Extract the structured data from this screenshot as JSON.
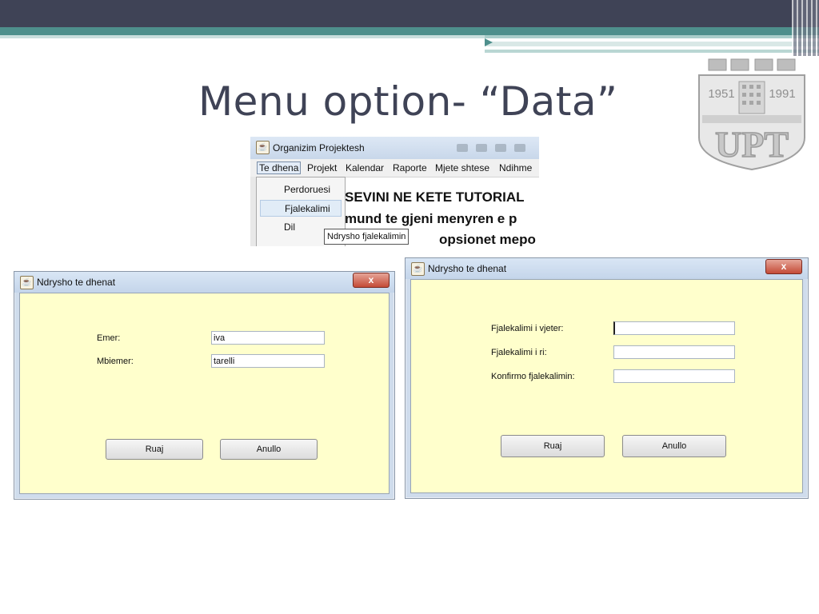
{
  "slide": {
    "title": "Menu option- “Data”"
  },
  "logo": {
    "year_left": "1951",
    "year_right": "1991",
    "text": "UPT"
  },
  "menu_window": {
    "title": "Organizim Projektesh",
    "menu": [
      "Te dhena",
      "Projekt",
      "Kalendar",
      "Raporte",
      "Mjete shtese",
      "Ndihme"
    ],
    "dropdown": [
      "Perdoruesi",
      "Fjalekalimi",
      "Dil"
    ],
    "tooltip": "Ndrysho fjalekalimin",
    "doc_lines": [
      "SEVINI NE KETE TUTORIAL",
      "mund te gjeni menyren e p",
      "opsionet mepo"
    ]
  },
  "user_dialog": {
    "title": "Ndrysho te dhenat",
    "close": "x",
    "fields": [
      {
        "label": "Emer:",
        "value": "iva"
      },
      {
        "label": "Mbiemer:",
        "value": "tarelli"
      }
    ],
    "buttons": {
      "save": "Ruaj",
      "cancel": "Anullo"
    }
  },
  "password_dialog": {
    "title": "Ndrysho te dhenat",
    "close": "x",
    "fields": [
      {
        "label": "Fjalekalimi i vjeter:",
        "value": ""
      },
      {
        "label": "Fjalekalimi i ri:",
        "value": ""
      },
      {
        "label": "Konfirmo fjalekalimin:",
        "value": ""
      }
    ],
    "buttons": {
      "save": "Ruaj",
      "cancel": "Anullo"
    }
  },
  "colors": {
    "header_dark": "#3f4356",
    "header_teal": "#4e8f8c",
    "dialog_bg": "#ffffcc"
  }
}
